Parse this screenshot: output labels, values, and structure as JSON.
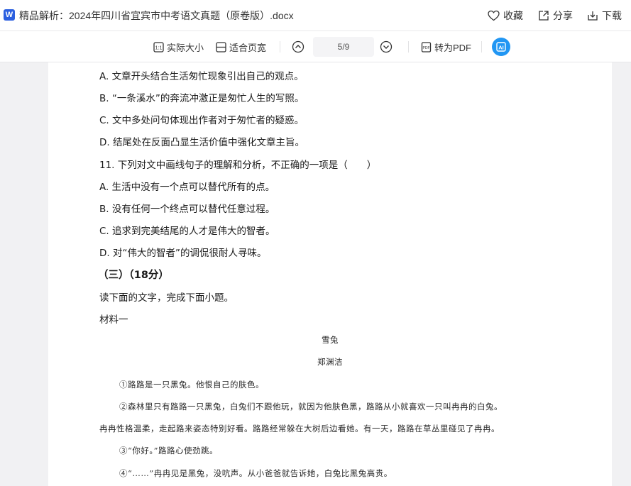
{
  "titlebar": {
    "app_badge": "W",
    "title": "精品解析：2024年四川省宜宾市中考语文真题（原卷版）.docx",
    "actions": {
      "favorite": "收藏",
      "share": "分享",
      "download": "下载"
    }
  },
  "toolbar": {
    "actual_size": "实际大小",
    "fit_width": "适合页宽",
    "page_indicator": "5/9",
    "to_pdf": "转为PDF"
  },
  "colors": {
    "word_blue": "#2b5fe0",
    "ai_blue": "#2196f3"
  },
  "icons": [
    "word-icon",
    "heart-icon",
    "share-icon",
    "download-icon",
    "actual-size-icon",
    "fit-width-icon",
    "page-up-icon",
    "page-down-icon",
    "pdf-icon",
    "ai-assistant-icon"
  ],
  "document": {
    "lines": [
      "A. 文章开头结合生活匆忙现象引出自己的观点。",
      "B. “一条溪水”的奔流冲激正是匆忙人生的写照。",
      "C. 文中多处问句体现出作者对于匆忙者的疑惑。",
      "D. 结尾处在反面凸显生活价值中强化文章主旨。",
      "11. 下列对文中画线句子的理解和分析，不正确的一项是（　　）",
      "A. 生活中没有一个点可以替代所有的点。",
      "B. 没有任何一个终点可以替代任意过程。",
      "C. 追求到完美结尾的人才是伟大的智者。",
      "D. 对“伟大的智者”的调侃很耐人寻味。"
    ],
    "section_heading": "（三）（18分）",
    "instruction": "读下面的文字，完成下面小题。",
    "material_label": "材料一",
    "scan": {
      "title": "雪兔",
      "author": "郑渊洁",
      "p1": "①路路是一只黑兔。他恨自己的肤色。",
      "p2a": "②森林里只有路路一只黑兔，白兔们不跟他玩，就因为他肤色黑，路路从小就喜欢一只叫冉冉的白兔。",
      "p2b": "冉冉性格温柔，走起路来姿态特别好看。路路经常躲在大树后边看她。有一天，路路在草丛里碰见了冉冉。",
      "p3": "③“你好。”路路心使劲跳。",
      "p4": "④“……”冉冉见是黑兔，没吭声。从小爸爸就告诉她，白兔比黑兔高贵。"
    }
  }
}
